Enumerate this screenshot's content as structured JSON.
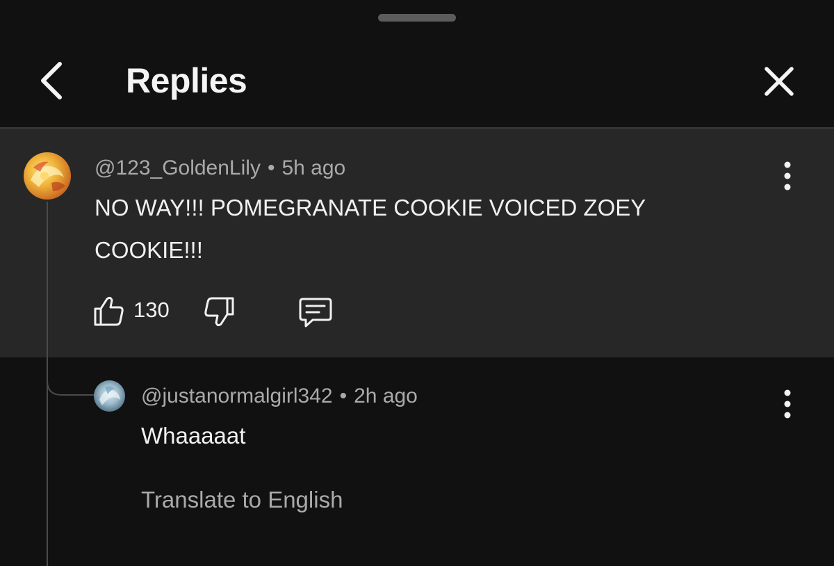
{
  "header": {
    "title": "Replies",
    "back_icon": "chevron-left-icon",
    "close_icon": "close-icon"
  },
  "comment": {
    "author": "@123_GoldenLily",
    "separator": "•",
    "time": "5h ago",
    "text_line1": "NO WAY!!! POMEGRANATE COOKIE VOICED ZOEY",
    "text_line2": "COOKIE!!!",
    "like_count": "130",
    "like_icon": "thumbs-up-icon",
    "dislike_icon": "thumbs-down-icon",
    "reply_icon": "comment-icon",
    "more_icon": "more-vert-icon"
  },
  "reply": {
    "author": "@justanormalgirl342",
    "separator": "•",
    "time": "2h ago",
    "text": "Whaaaaat",
    "translate_label": "Translate to English",
    "more_icon": "more-vert-icon"
  },
  "colors": {
    "background": "#111111",
    "comment_highlight": "#272727",
    "secondary_text": "#aaaaaa",
    "primary_text": "#f1f1f1"
  }
}
